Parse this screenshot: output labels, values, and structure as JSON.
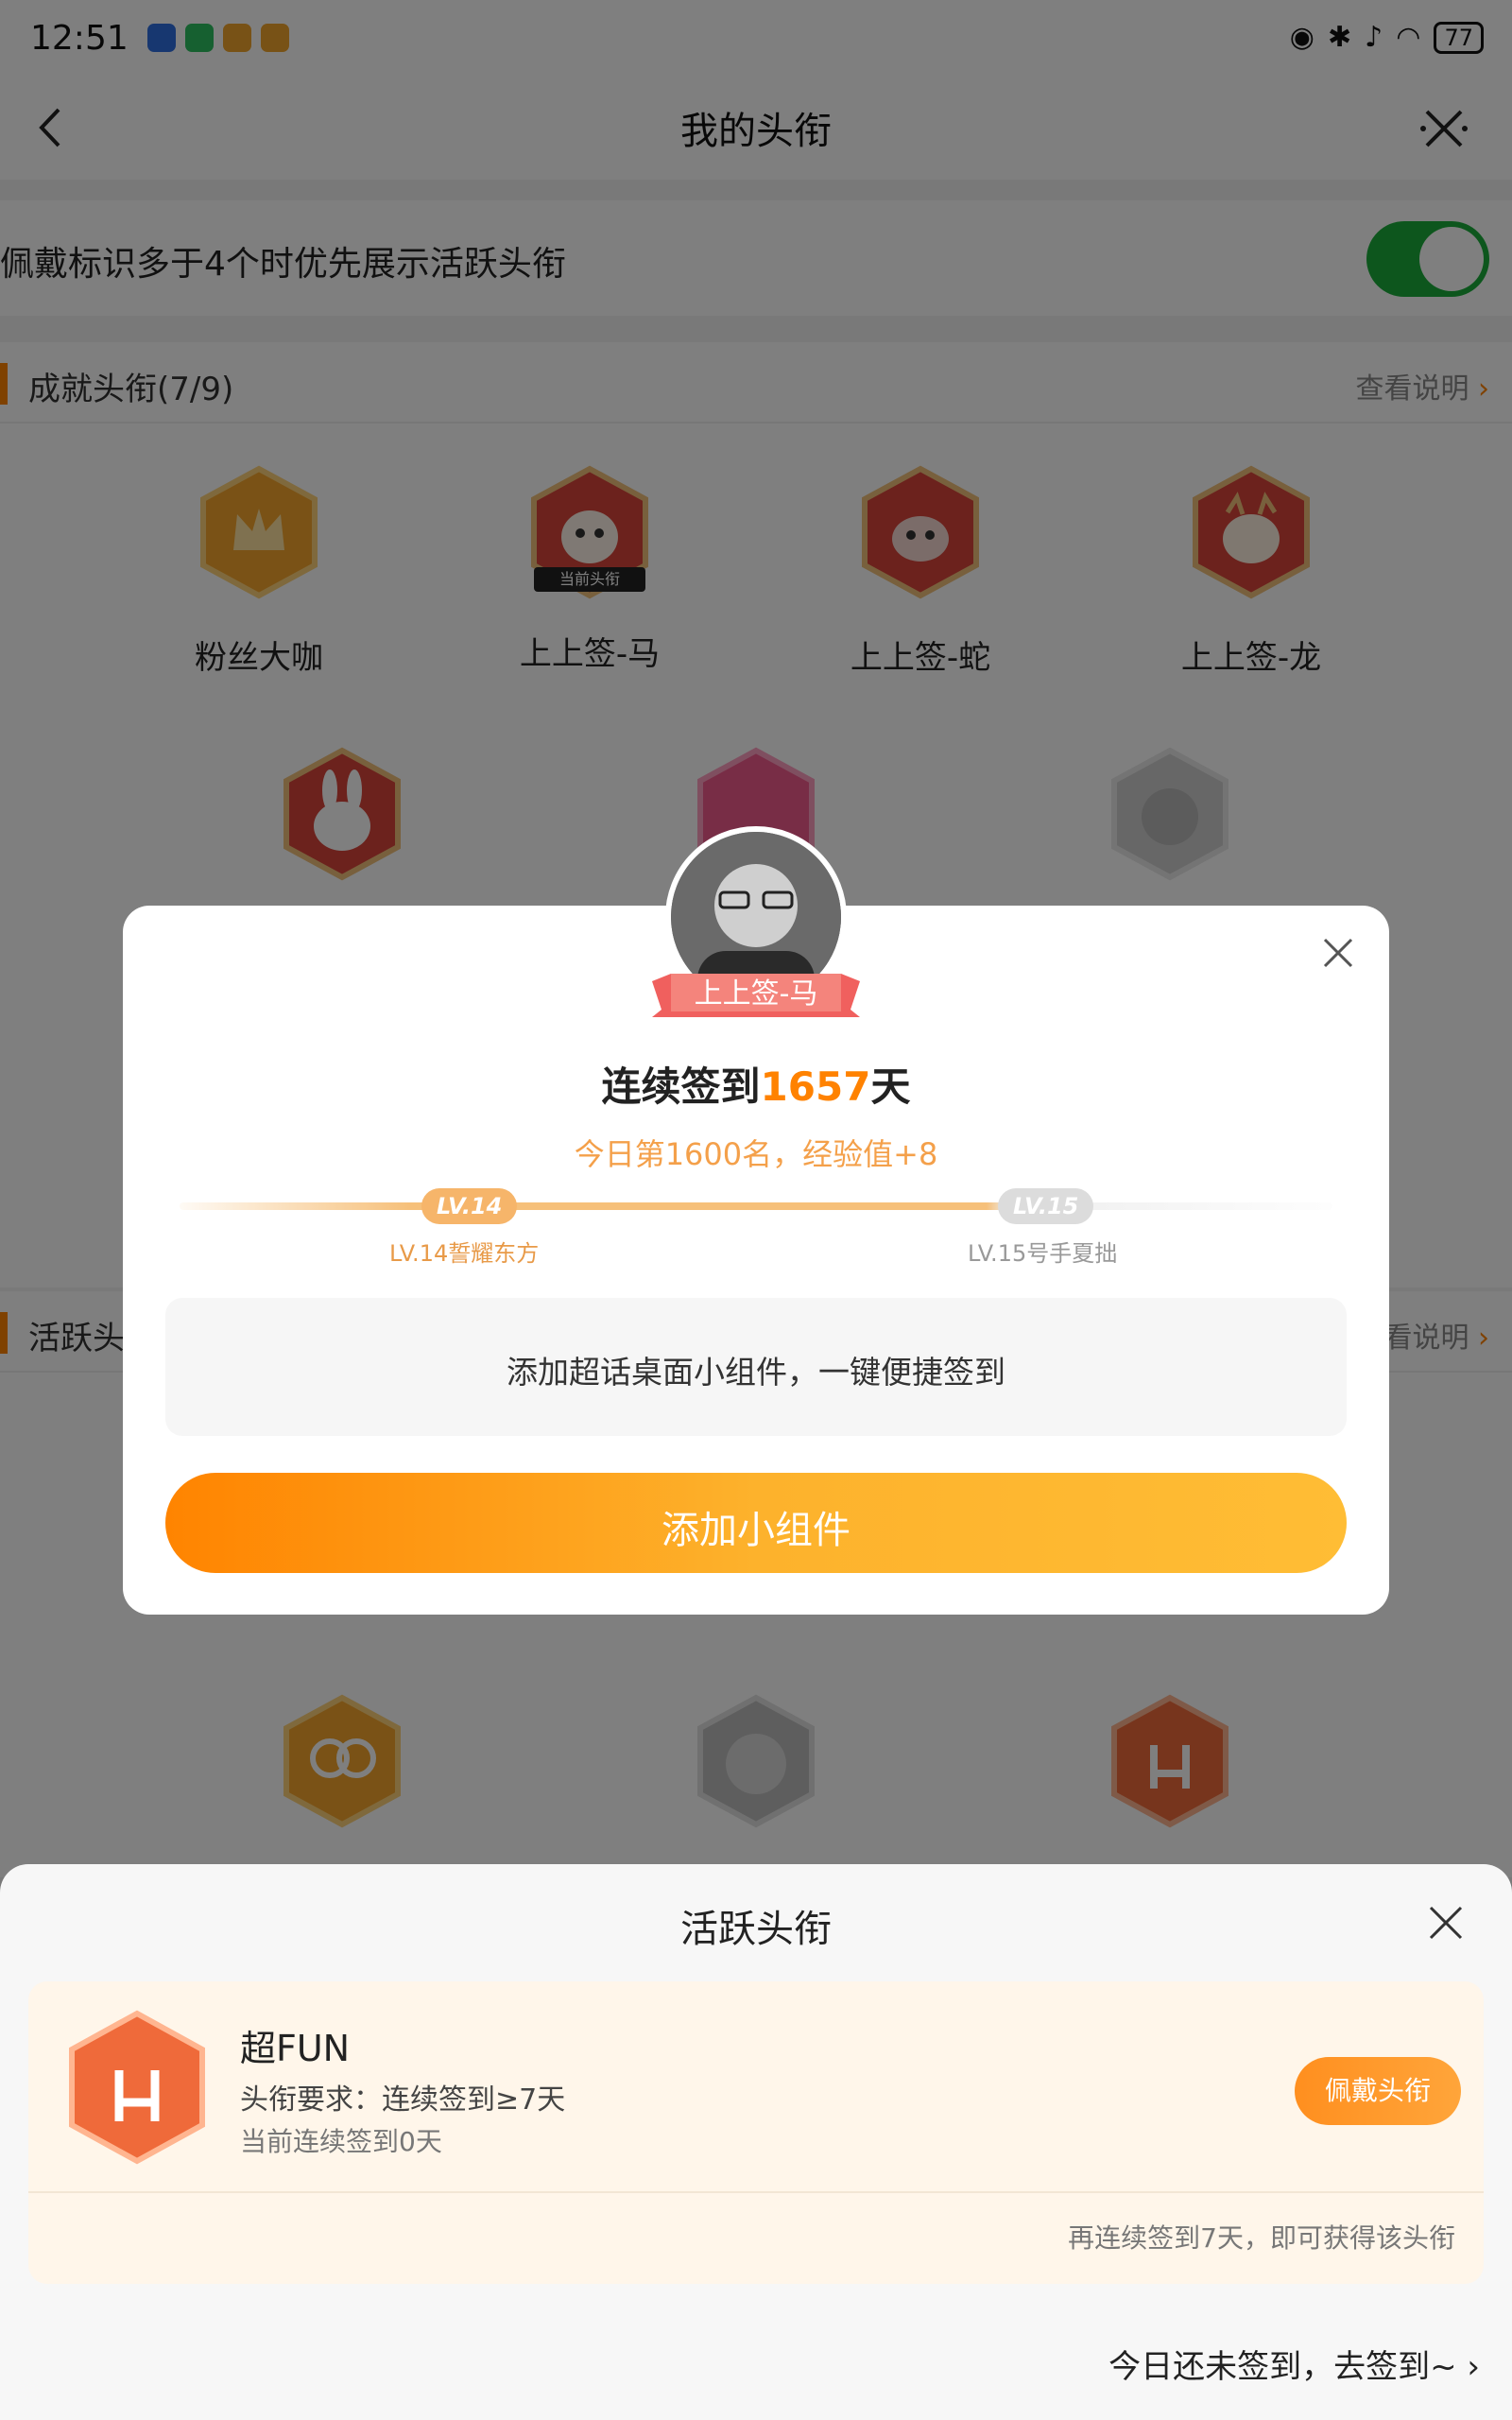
{
  "status_bar": {
    "time": "12:51",
    "battery": "77"
  },
  "nav": {
    "title": "我的头衔"
  },
  "settings": {
    "priority_toggle_label": "佩戴标识多于4个时优先展示活跃头衔",
    "priority_toggle_on": true
  },
  "achievement": {
    "title": "成就头衔(7/9)",
    "link": "查看说明",
    "badges": [
      {
        "label": "粉丝大咖",
        "icon": "crown-badge-icon"
      },
      {
        "label": "上上签-马",
        "icon": "horse-badge-icon",
        "tag": "当前头衔"
      },
      {
        "label": "上上签-蛇",
        "icon": "snake-badge-icon"
      },
      {
        "label": "上上签-龙",
        "icon": "dragon-badge-icon"
      },
      {
        "label": "",
        "icon": "rabbit-badge-icon"
      },
      {
        "label": "",
        "icon": "lv14-badge-icon"
      },
      {
        "label": "",
        "icon": "hi-badge-icon"
      }
    ]
  },
  "active": {
    "title": "活跃头",
    "link": "看说明",
    "badges": [
      {
        "label": "",
        "icon": "30-days-badge-icon"
      },
      {
        "label": "",
        "icon": "laughing-badge-icon"
      },
      {
        "label": "",
        "icon": "rock-hand-badge-icon"
      }
    ]
  },
  "popup": {
    "avatar_title": "上上签-马",
    "signin_prefix": "连续签到",
    "signin_days": "1657",
    "signin_suffix": "天",
    "rank_text": "今日第1600名，经验值+8",
    "current_level": "LV.14",
    "next_level": "LV.15",
    "current_level_name": "LV.14誓耀东方",
    "next_level_name": "LV.15号手夏拙",
    "widget_text": "添加超话桌面小组件，一键便捷签到",
    "add_button": "添加小组件"
  },
  "sheet": {
    "title": "活跃头衔",
    "badge_name": "超FUN",
    "requirement": "头衔要求：连续签到≥7天",
    "current": "当前连续签到0天",
    "wear_button": "佩戴头衔",
    "hint": "再连续签到7天，即可获得该头衔",
    "footer_link": "今日还未签到，去签到~"
  },
  "colors": {
    "accent": "#ff8200",
    "toggle_on": "#1aad3a",
    "badge_red": "#d8453a"
  }
}
